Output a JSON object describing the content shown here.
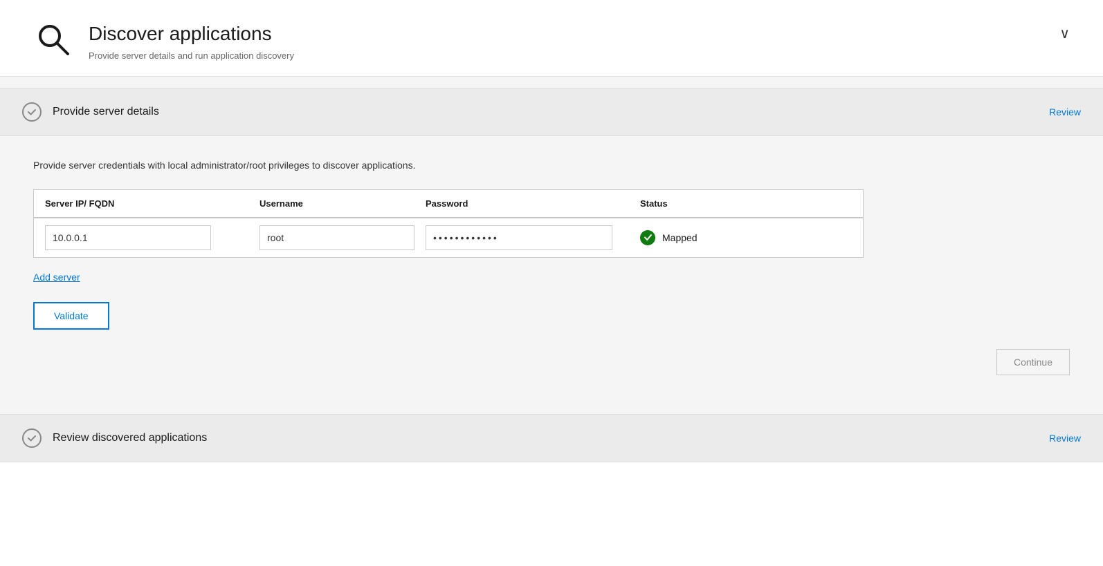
{
  "header": {
    "title": "Discover applications",
    "subtitle": "Provide server details and run application discovery",
    "collapse_icon": "∨"
  },
  "step1": {
    "title": "Provide server details",
    "review_label": "Review",
    "description": "Provide server credentials with local administrator/root privileges to discover applications.",
    "table": {
      "columns": [
        "Server IP/ FQDN",
        "Username",
        "Password",
        "Status"
      ],
      "rows": [
        {
          "server_ip": "10.0.0.1",
          "username": "root",
          "password": "••••••••••",
          "status": "Mapped"
        }
      ]
    },
    "add_server_label": "Add server",
    "validate_label": "Validate",
    "continue_label": "Continue"
  },
  "step2": {
    "title": "Review discovered applications",
    "review_label": "Review"
  }
}
